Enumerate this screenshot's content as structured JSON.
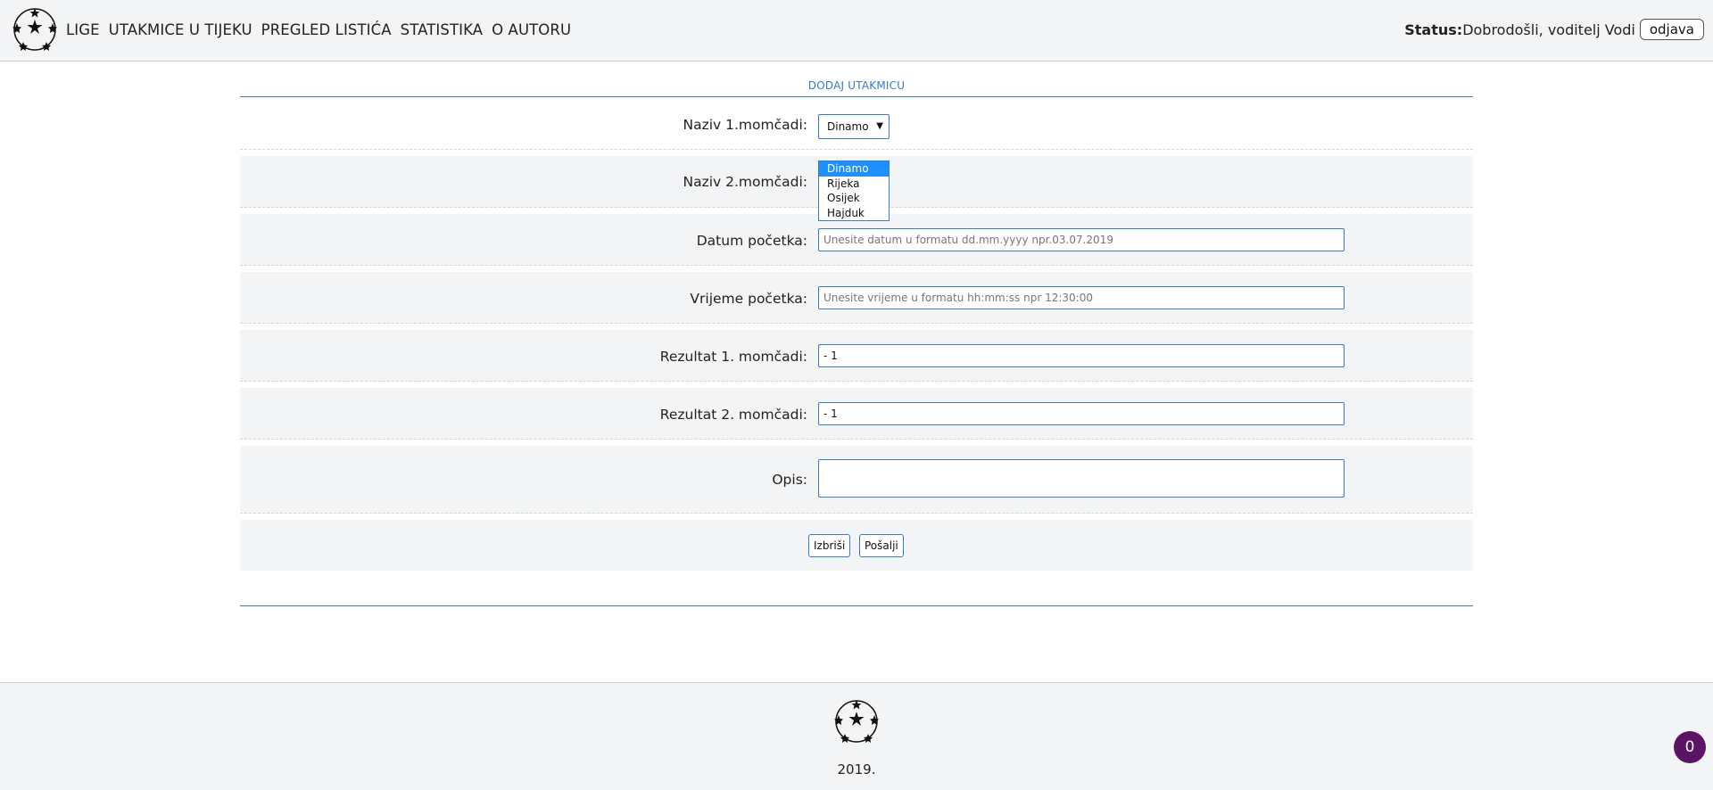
{
  "header": {
    "logo_icon": "starball-icon",
    "nav": [
      "LIGE",
      "UTAKMICE U TIJEKU",
      "PREGLED LISTIĆA",
      "STATISTIKA",
      "O AUTORU"
    ],
    "status_label": "Status:",
    "status_text": "Dobrodošli, voditelj Vodi",
    "logout_label": "odjava"
  },
  "form": {
    "title": "DODAJ UTAKMICU",
    "team1_label": "Naziv 1.momčadi:",
    "team1_selected": "Dinamo",
    "team1_options": [
      "Dinamo",
      "Rijeka",
      "Osijek",
      "Hajduk"
    ],
    "team2_label": "Naziv 2.momčadi:",
    "date_label": "Datum početka:",
    "date_placeholder": "Unesite datum u formatu dd.mm.yyyy npr.03.07.2019",
    "time_label": "Vrijeme početka:",
    "time_placeholder": "Unesite vrijeme u formatu hh:mm:ss npr 12:30:00",
    "result1_label": "Rezultat 1. momčadi:",
    "result1_value": "- 1",
    "result2_label": "Rezultat 2. momčadi:",
    "result2_value": "- 1",
    "desc_label": "Opis:",
    "desc_value": "",
    "clear_label": "Izbriši",
    "submit_label": "Pošalji"
  },
  "footer": {
    "logo_icon": "starball-icon",
    "year": "2019."
  },
  "badge": {
    "count": "0",
    "color": "#5a1463"
  },
  "colors": {
    "accent": "#3b79c9",
    "header_bg": "#f3f4f5",
    "selected": "#1e90ff"
  }
}
